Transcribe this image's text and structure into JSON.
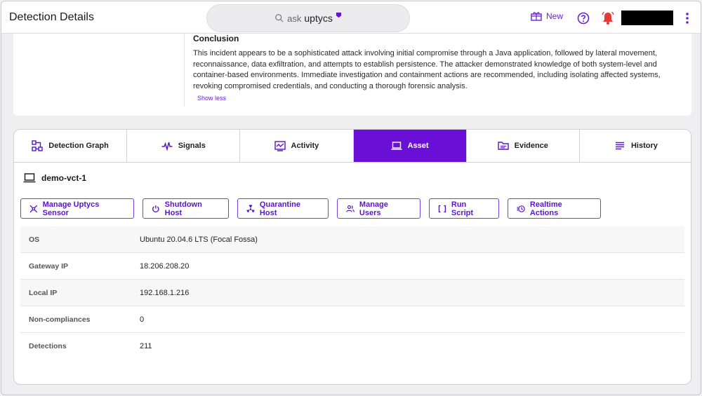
{
  "header": {
    "title": "Detection Details",
    "ask_prefix": "ask",
    "ask_brand": "uptycs",
    "new_label": "New"
  },
  "conclusion": {
    "title": "Conclusion",
    "text": "This incident appears to be a sophisticated attack involving initial compromise through a Java application, followed by lateral movement, reconnaissance, data exfiltration, and attempts to establish persistence. The attacker demonstrated knowledge of both system-level and container-based environments. Immediate investigation and containment actions are recommended, including isolating affected systems, revoking compromised credentials, and conducting a thorough forensic analysis.",
    "show_less": "Show less"
  },
  "tabs": [
    {
      "label": "Detection Graph",
      "icon": "graph-icon"
    },
    {
      "label": "Signals",
      "icon": "pulse-icon"
    },
    {
      "label": "Activity",
      "icon": "activity-icon"
    },
    {
      "label": "Asset",
      "icon": "laptop-icon",
      "active": true
    },
    {
      "label": "Evidence",
      "icon": "folder-icon"
    },
    {
      "label": "History",
      "icon": "list-icon"
    }
  ],
  "asset": {
    "name": "demo-vct-1",
    "actions": [
      {
        "label": "Manage Uptycs Sensor",
        "icon": "sensor-icon"
      },
      {
        "label": "Shutdown Host",
        "icon": "power-icon"
      },
      {
        "label": "Quarantine Host",
        "icon": "radiation-icon"
      },
      {
        "label": "Manage Users",
        "icon": "users-icon"
      },
      {
        "label": "Run Script",
        "icon": "brackets-icon"
      },
      {
        "label": "Realtime Actions",
        "icon": "realtime-icon"
      }
    ],
    "properties": [
      {
        "key": "OS",
        "value": "Ubuntu 20.04.6 LTS (Focal Fossa)"
      },
      {
        "key": "Gateway IP",
        "value": "18.206.208.20"
      },
      {
        "key": "Local IP",
        "value": "192.168.1.216"
      },
      {
        "key": "Non-compliances",
        "value": "0"
      },
      {
        "key": "Detections",
        "value": "211"
      }
    ]
  },
  "colors": {
    "accent": "#6a10d6",
    "alert": "#e53935"
  }
}
